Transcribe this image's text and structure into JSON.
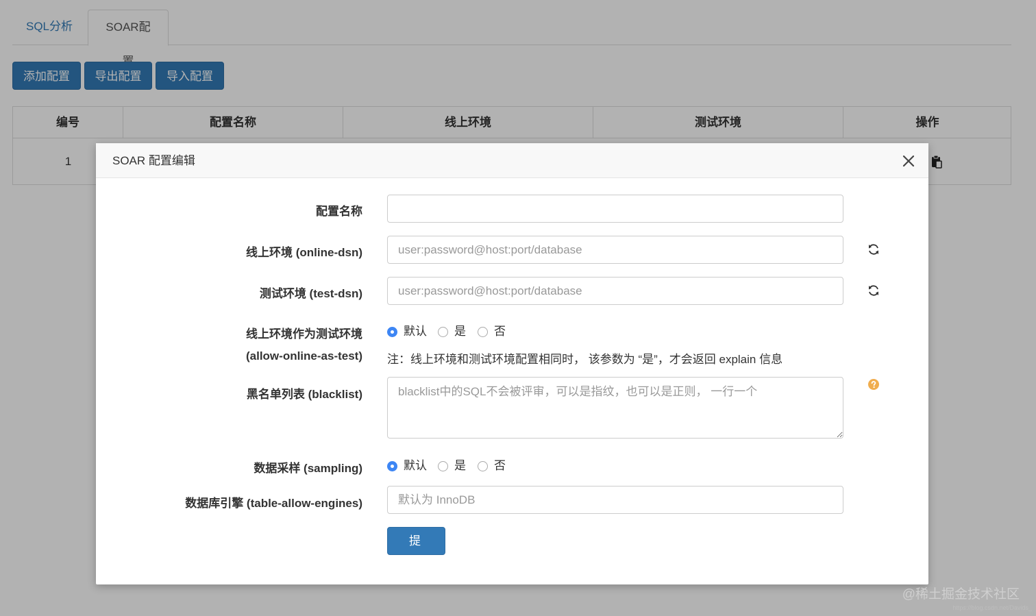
{
  "tabs": [
    {
      "label": "SQL分析"
    },
    {
      "label": "SOAR配置"
    }
  ],
  "toolbar": {
    "add_label": "添加配置",
    "export_label": "导出配置",
    "import_label": "导入配置"
  },
  "table": {
    "headers": [
      "编号",
      "配置名称",
      "线上环境",
      "测试环境",
      "操作"
    ],
    "rows": [
      {
        "id": "1"
      }
    ]
  },
  "modal": {
    "title": "SOAR 配置编辑",
    "fields": {
      "name": {
        "label": "配置名称",
        "value": "",
        "placeholder": ""
      },
      "online_dsn": {
        "label": "线上环境 (online-dsn)",
        "value": "",
        "placeholder": "user:password@host:port/database"
      },
      "test_dsn": {
        "label": "测试环境 (test-dsn)",
        "value": "",
        "placeholder": "user:password@host:port/database"
      },
      "allow_online": {
        "label_line1": "线上环境作为测试环境",
        "label_line2": "(allow-online-as-test)",
        "options": [
          "默认",
          "是",
          "否"
        ],
        "selected": "默认",
        "note": "注：线上环境和测试环境配置相同时， 该参数为 “是”，才会返回 explain 信息"
      },
      "blacklist": {
        "label": "黑名单列表 (blacklist)",
        "value": "",
        "placeholder": "blacklist中的SQL不会被评审，可以是指纹，也可以是正则， 一行一个"
      },
      "sampling": {
        "label": "数据采样 (sampling)",
        "options": [
          "默认",
          "是",
          "否"
        ],
        "selected": "默认"
      },
      "engines": {
        "label": "数据库引擎 (table-allow-engines)",
        "value": "",
        "placeholder": "默认为 InnoDB"
      }
    },
    "submit_label": "提 交"
  },
  "watermark": {
    "text": "@稀土掘金技术社区",
    "url": "https://blog.csdn.net/Davids_"
  },
  "colors": {
    "primary": "#337ab7",
    "radio_checked": "#3d86f4",
    "help_icon": "#f0ad4e"
  },
  "icons": [
    "clipboard-icon",
    "close-icon",
    "refresh-icon",
    "question-circle-icon"
  ]
}
